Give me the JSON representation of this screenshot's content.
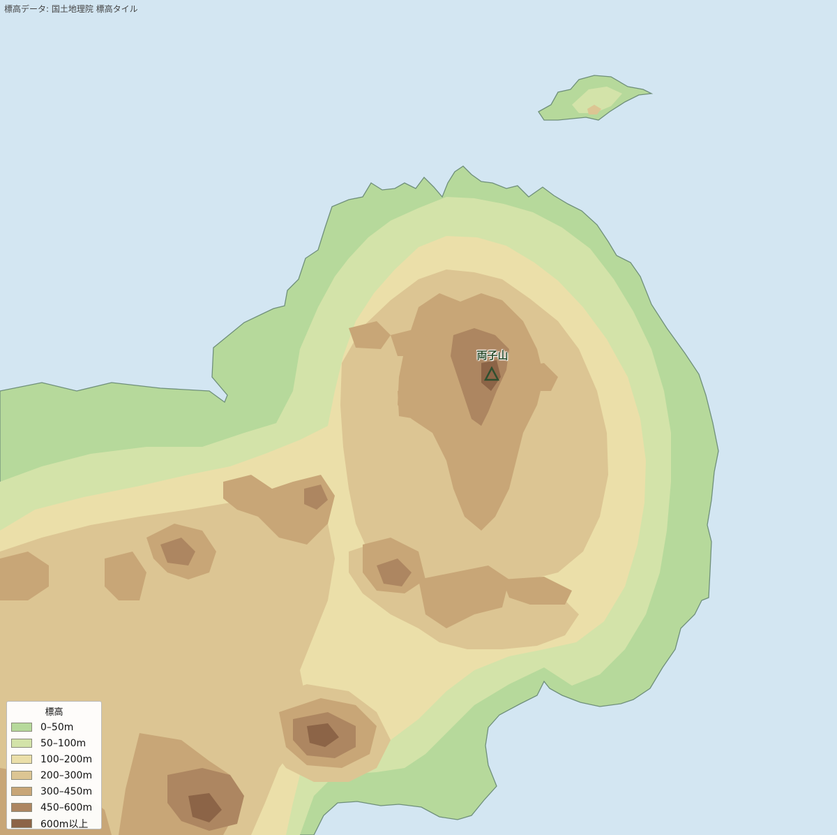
{
  "map": {
    "attribution": "標高データ: 国土地理院 標高タイル",
    "colors": {
      "sea": "#d3e6f2",
      "coast": "#6f8f7a",
      "band_0_50": "#b6d99b",
      "band_50_100": "#d3e3a9",
      "band_100_200": "#ebdfa9",
      "band_200_300": "#dcc593",
      "band_300_450": "#c8a677",
      "band_450_600": "#ad8661",
      "band_600_plus": "#8c6447"
    },
    "peak": {
      "name": "両子山",
      "icon": "triangle-peak-icon",
      "color": "#2f4f2f"
    }
  },
  "legend": {
    "title": "標高",
    "items": [
      {
        "label": "0–50m",
        "color": "#b6d99b"
      },
      {
        "label": "50–100m",
        "color": "#d3e3a9"
      },
      {
        "label": "100–200m",
        "color": "#ebdfa9"
      },
      {
        "label": "200–300m",
        "color": "#dcc593"
      },
      {
        "label": "300–450m",
        "color": "#c8a677"
      },
      {
        "label": "450–600m",
        "color": "#ad8661"
      },
      {
        "label": "600m以上",
        "color": "#8c6447"
      }
    ]
  }
}
